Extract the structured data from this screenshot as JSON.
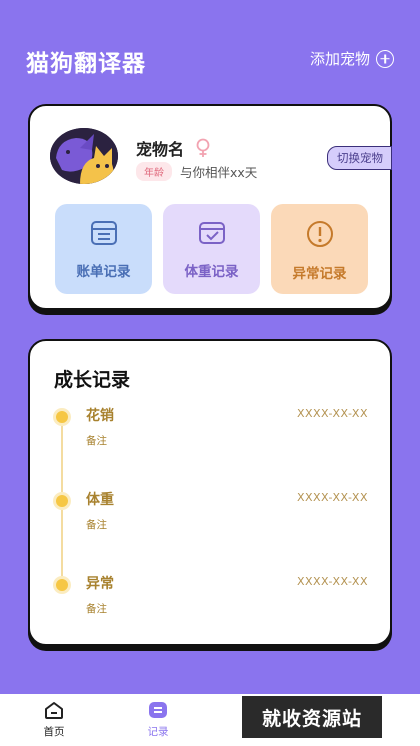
{
  "header": {
    "title": "猫狗翻译器",
    "add_pet_label": "添加宠物"
  },
  "pet": {
    "name": "宠物名",
    "age_badge": "年龄",
    "companion_text": "与你相伴xx天",
    "switch_label": "切换宠物"
  },
  "shortcuts": [
    {
      "label": "账单记录",
      "icon": "bill-icon"
    },
    {
      "label": "体重记录",
      "icon": "weight-icon"
    },
    {
      "label": "异常记录",
      "icon": "alert-icon"
    }
  ],
  "growth": {
    "title": "成长记录",
    "items": [
      {
        "title": "花销",
        "date": "XXXX-XX-XX",
        "note": "备注"
      },
      {
        "title": "体重",
        "date": "XXXX-XX-XX",
        "note": "备注"
      },
      {
        "title": "异常",
        "date": "XXXX-XX-XX",
        "note": "备注"
      }
    ]
  },
  "tabbar": {
    "home_label": "首页",
    "record_label": "记录"
  },
  "watermark": "就收资源站",
  "colors": {
    "background": "#8a74ee",
    "accent": "#8a74ee",
    "timeline_dot": "#f6c744"
  }
}
